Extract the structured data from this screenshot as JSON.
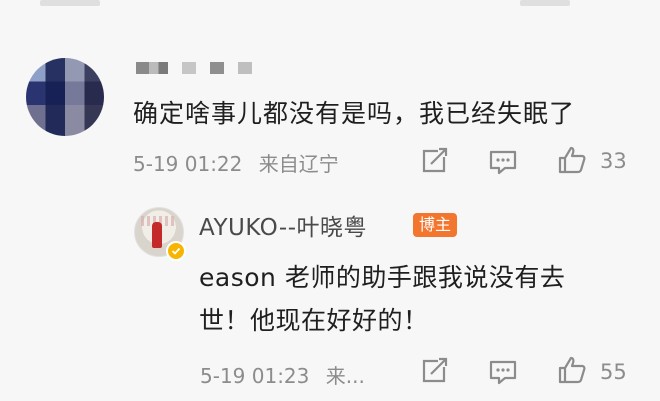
{
  "comment": {
    "text": "确定啥事儿都没有是吗，我已经失眠了",
    "date": "5-19  01:22",
    "location": "来自辽宁",
    "likes": "33"
  },
  "reply": {
    "author": "AYUKO--叶晓粤",
    "badge": "博主",
    "text_line1": "eason 老师的助手跟我说没有去",
    "text_line2": "世！他现在好好的！",
    "date": "5-19  01:23",
    "location": "来...",
    "likes": "55"
  },
  "icons": [
    "share-icon",
    "comment-icon",
    "like-icon",
    "verified-badge-icon"
  ],
  "colors": {
    "accent": "#f2762e",
    "verified": "#f7b500",
    "meta": "#8c8c8c"
  }
}
